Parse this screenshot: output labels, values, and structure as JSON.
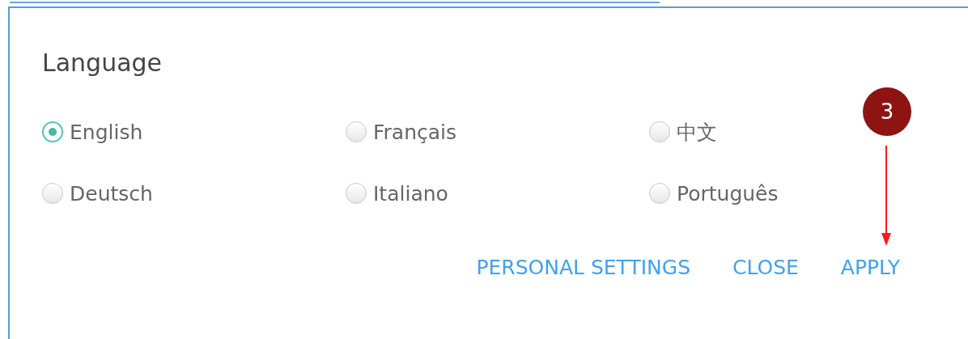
{
  "dialog": {
    "title": "Language",
    "options": [
      {
        "label": "English",
        "selected": true
      },
      {
        "label": "Français",
        "selected": false
      },
      {
        "label": "中文",
        "selected": false
      },
      {
        "label": "Deutsch",
        "selected": false
      },
      {
        "label": "Italiano",
        "selected": false
      },
      {
        "label": "Português",
        "selected": false
      }
    ],
    "buttons": [
      "PERSONAL SETTINGS",
      "CLOSE",
      "APPLY"
    ]
  },
  "annotation": {
    "step": "3"
  }
}
